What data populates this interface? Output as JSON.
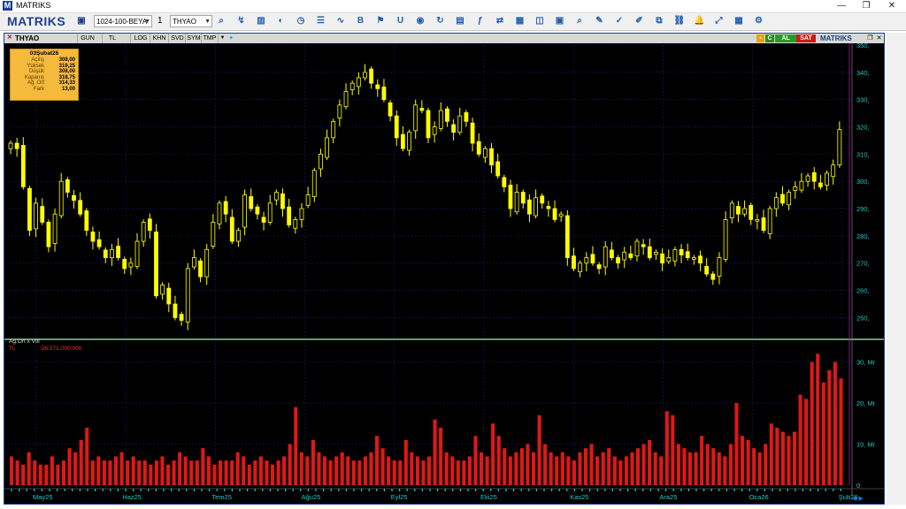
{
  "window": {
    "title": "MATRIKS",
    "logo": "M",
    "controls": [
      "—",
      "❐",
      "✕"
    ]
  },
  "toolbar": {
    "brand": "MATRIKS",
    "layout_select": "1024-100-BEYA",
    "chart_count": "1",
    "symbol_select": "THYAO",
    "icons": [
      "save-icon",
      "zoom-in-icon",
      "draw-icon",
      "chart-type-icon",
      "color-icon",
      "clock-icon",
      "list-icon",
      "indicator-icon",
      "bold-icon",
      "alarm-icon",
      "u-icon",
      "circle-icon",
      "refresh-icon",
      "news-icon",
      "function-icon",
      "compare-icon",
      "grid-icon",
      "split-icon",
      "table-icon",
      "search-icon",
      "pen-icon",
      "check-icon",
      "edit-icon",
      "copy-icon",
      "link-icon",
      "bell-icon",
      "expand-icon",
      "calc-icon",
      "settings-icon"
    ]
  },
  "chart_header": {
    "symbol": "THYAO",
    "tabs": [
      "GUN",
      "TL",
      "LOG",
      "KHN",
      "SVD",
      "SYM",
      "TMP"
    ],
    "buttons": {
      "c": "C",
      "al": "AL",
      "sat": "SAT"
    },
    "brand": "MATRIKS"
  },
  "info_box": {
    "date": "03Şubat26",
    "rows": [
      {
        "label": "Açılış",
        "value": "308,00"
      },
      {
        "label": "Yüksek",
        "value": "319,25"
      },
      {
        "label": "Düşük",
        "value": "308,00"
      },
      {
        "label": "Kapanış",
        "value": "318,75"
      },
      {
        "label": "Ağ. Ort",
        "value": "314,33"
      },
      {
        "label": "Fark",
        "value": "13,00"
      }
    ]
  },
  "volume_legend": {
    "title": "Ag.Ort x Vol",
    "unit": "TL",
    "range": ":26.571-200.000"
  },
  "colors": {
    "candle": "#ffff00",
    "volume": "#e01818",
    "axis_text": "#20c8c8",
    "grid": "#1a1a6a",
    "cursor": "#a020a0"
  },
  "chart_data": [
    {
      "type": "candlestick",
      "title": "THYAO",
      "ylim": [
        243,
        350
      ],
      "yticks": [
        250,
        260,
        270,
        280,
        290,
        300,
        310,
        320,
        330,
        340,
        350
      ],
      "ytick_labels": [
        "250,",
        "260,",
        "270,",
        "280,",
        "290,",
        "300,",
        "310,",
        "320,",
        "330,",
        "340,",
        "350,"
      ],
      "x_labels": [
        "May25",
        "Haz25",
        "Tem25",
        "Ağu25",
        "Eyl25",
        "Eki25",
        "Kas25",
        "Ara25",
        "Oca26",
        "Şub26"
      ],
      "closes": [
        314,
        312,
        298,
        282,
        292,
        285,
        276,
        288,
        300,
        296,
        293,
        288,
        282,
        278,
        276,
        272,
        275,
        272,
        268,
        270,
        278,
        285,
        282,
        258,
        262,
        255,
        250,
        249,
        268,
        272,
        265,
        275,
        285,
        292,
        288,
        278,
        282,
        295,
        290,
        288,
        285,
        292,
        296,
        290,
        284,
        286,
        290,
        295,
        304,
        310,
        316,
        322,
        328,
        333,
        336,
        338,
        340,
        336,
        334,
        330,
        324,
        316,
        312,
        318,
        328,
        326,
        316,
        320,
        326,
        322,
        318,
        324,
        322,
        314,
        310,
        312,
        306,
        302,
        298,
        290,
        296,
        292,
        288,
        294,
        292,
        290,
        286,
        288,
        272,
        268,
        270,
        272,
        270,
        268,
        276,
        272,
        270,
        274,
        272,
        278,
        276,
        272,
        274,
        270,
        272,
        275,
        273,
        272,
        272,
        270,
        266,
        264,
        272,
        286,
        292,
        288,
        290,
        286,
        286,
        282,
        290,
        294,
        292,
        296,
        298,
        300,
        302,
        300,
        298,
        303,
        306,
        319
      ],
      "volume": {
        "ylim": [
          0,
          34
        ],
        "yticks": [
          0,
          10,
          20,
          30
        ],
        "ytick_labels": [
          "0",
          "10, Mr",
          "20, Mr",
          "30, Mr"
        ],
        "values": [
          7,
          6,
          5,
          8,
          6,
          5,
          5,
          7,
          5,
          6,
          9,
          8,
          11,
          14,
          6,
          7,
          6,
          6,
          7,
          8,
          6,
          7,
          6,
          6,
          5,
          6,
          7,
          5,
          6,
          8,
          7,
          6,
          6,
          9,
          7,
          5,
          6,
          6,
          6,
          8,
          7,
          5,
          6,
          7,
          6,
          5,
          6,
          7,
          10,
          19,
          8,
          7,
          11,
          8,
          7,
          6,
          7,
          8,
          7,
          6,
          6,
          7,
          8,
          12,
          9,
          7,
          6,
          6,
          11,
          8,
          7,
          6,
          7,
          16,
          14,
          8,
          7,
          6,
          6,
          7,
          12,
          8,
          7,
          15,
          12,
          9,
          7,
          8,
          9,
          10,
          8,
          17,
          10,
          8,
          7,
          8,
          7,
          6,
          8,
          9,
          10,
          7,
          8,
          9,
          7,
          6,
          7,
          8,
          9,
          10,
          11,
          8,
          7,
          18,
          17,
          10,
          9,
          8,
          8,
          12,
          10,
          9,
          8,
          7,
          10,
          20,
          12,
          11,
          9,
          8,
          10,
          15,
          14,
          13,
          12,
          13,
          22,
          21,
          30,
          32,
          25,
          28,
          30,
          26
        ]
      }
    }
  ]
}
